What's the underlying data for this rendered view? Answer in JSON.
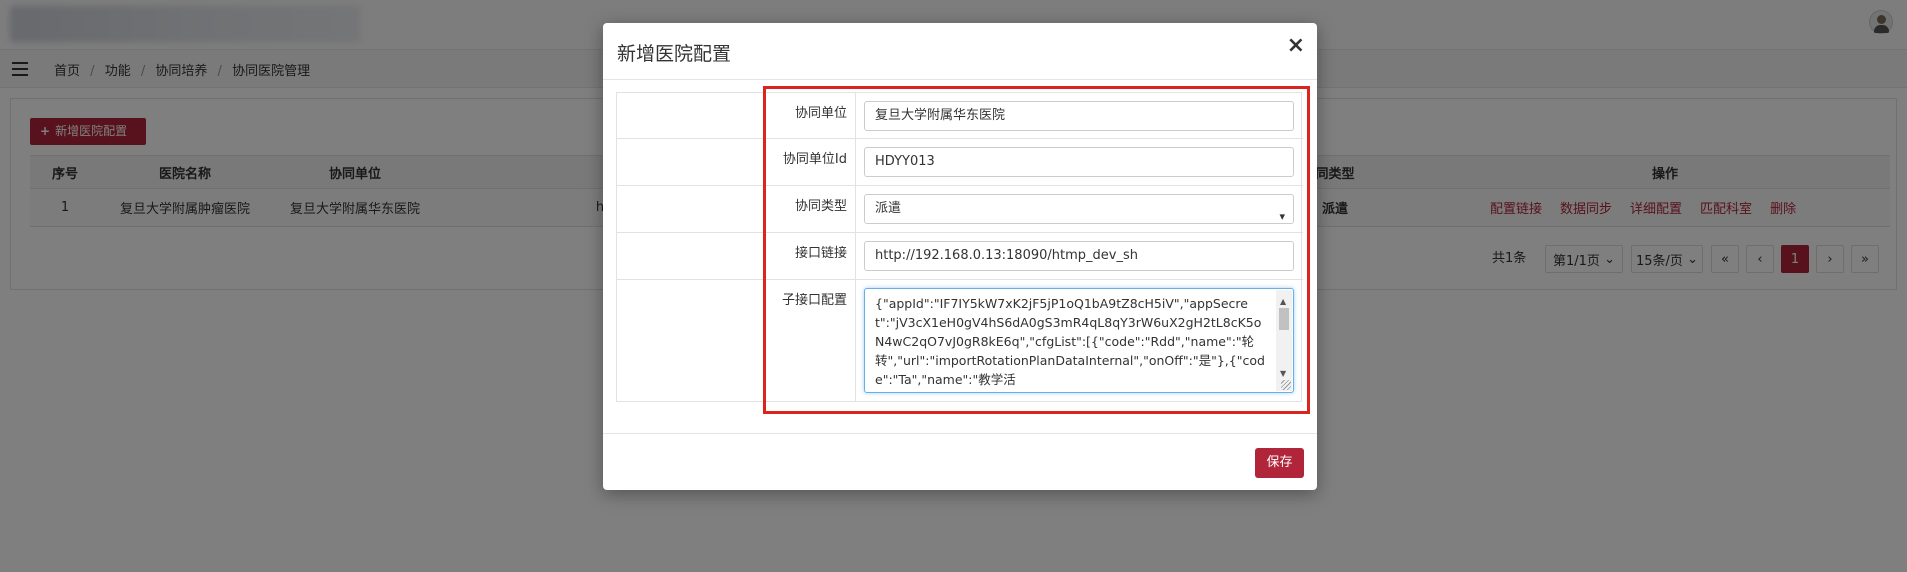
{
  "header": {
    "avatar_icon": "user-avatar-icon"
  },
  "breadcrumb": {
    "items": [
      "首页",
      "功能",
      "协同培养",
      "协同医院管理"
    ],
    "separator": "/"
  },
  "page": {
    "add_button_label": "新增医院配置",
    "table": {
      "columns": [
        "序号",
        "医院名称",
        "协同单位",
        "同类型",
        "操作"
      ],
      "rows": [
        {
          "index": "1",
          "hospital": "复旦大学附属肿瘤医院",
          "unit": "复旦大学附属华东医院",
          "partial": "h",
          "type": "派遣"
        }
      ],
      "actions": [
        "配置链接",
        "数据同步",
        "详细配置",
        "匹配科室",
        "删除"
      ]
    },
    "pagination": {
      "total": "共1条",
      "page_select": "第1/1页",
      "size_select": "15条/页",
      "first": "«",
      "prev": "‹",
      "current": "1",
      "next": "›",
      "last": "»"
    }
  },
  "modal": {
    "title": "新增医院配置",
    "close": "×",
    "fields": {
      "unit": {
        "label": "协同单位",
        "value": "复旦大学附属华东医院"
      },
      "unit_id": {
        "label": "协同单位Id",
        "value": "HDYY013"
      },
      "type": {
        "label": "协同类型",
        "value": "派遣"
      },
      "api_link": {
        "label": "接口链接",
        "value": "http://192.168.0.13:18090/htmp_dev_sh"
      },
      "sub_config": {
        "label": "子接口配置",
        "value": "{\"appId\":\"IF7IY5kW7xK2jF5jP1oQ1bA9tZ8cH5iV\",\"appSecret\":\"jV3cX1eH0gV4hS6dA0gS3mR4qL8qY3rW6uX2gH2tL8cK5oN4wC2qO7vJ0gR8kE6q\",\"cfgList\":[{\"code\":\"Rdd\",\"name\":\"轮转\",\"url\":\"importRotationPlanDataInternal\",\"onOff\":\"是\"},{\"code\":\"Ta\",\"name\":\"教学活"
      }
    },
    "save_label": "保存"
  },
  "colors": {
    "brand": "#b0253a",
    "highlight": "#d9251d",
    "focus": "#66afe9"
  }
}
